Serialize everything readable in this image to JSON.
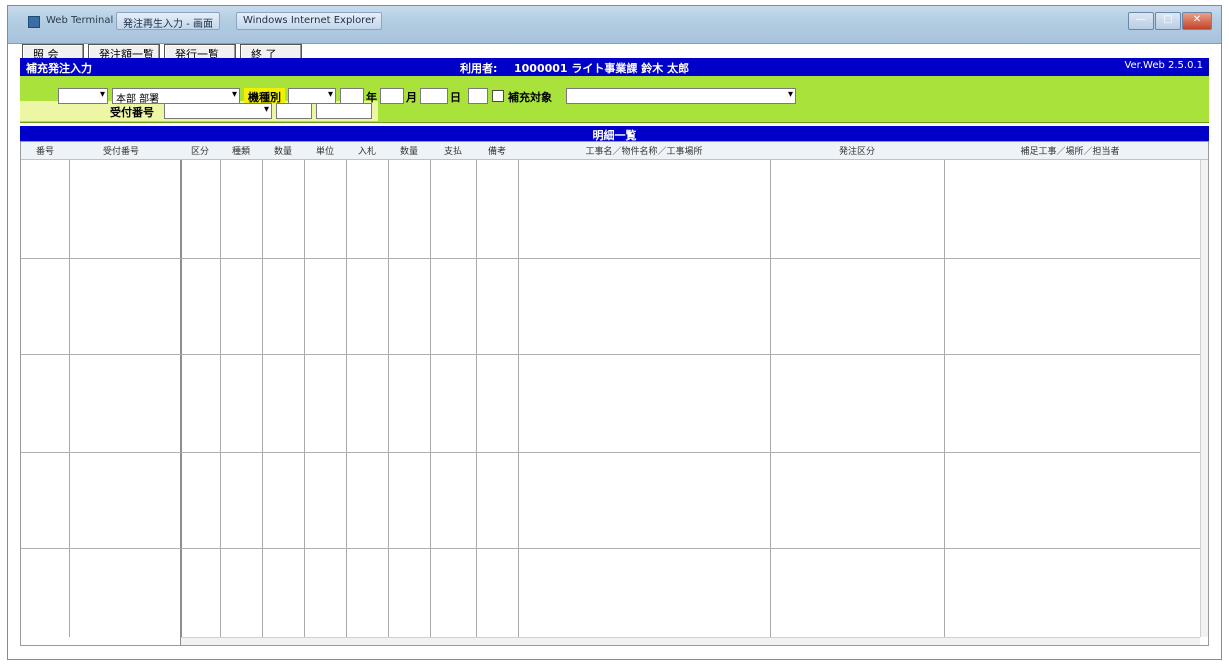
{
  "window": {
    "title": "Web Terminal",
    "tabs": [
      "発注再生入力 - 画面",
      "Windows Internet Explorer"
    ],
    "controls": {
      "minimize": "—",
      "maximize": "□",
      "close": "✕"
    }
  },
  "menu": {
    "buttons": [
      "照 会",
      "発注額一覧",
      "発行一覧",
      "終 了"
    ]
  },
  "header": {
    "screen_title": "補充発注入力",
    "user_label": "利用者:",
    "user_value": "1000001 ライト事業課 鈴木 太郎",
    "version": "Ver.Web 2.5.0.1"
  },
  "filter": {
    "select_1": "",
    "select_2": "本部 部署",
    "label_dept": "機種別",
    "select_3": "",
    "label_year": "年",
    "label_month": "月",
    "label_day": "日",
    "checkbox_label": "補充対象",
    "select_wide": "",
    "label_code": "受付番号",
    "select_code": "",
    "input_a": "",
    "input_b": ""
  },
  "list": {
    "title": "明細一覧",
    "columns": [
      "番号",
      "受付番号",
      "区分",
      "種類",
      "数量",
      "単位",
      "入札",
      "数量",
      "支払",
      "備考",
      "工事名／物件名称／工事場所",
      "発注区分",
      "補足工事／場所／担当者"
    ]
  }
}
